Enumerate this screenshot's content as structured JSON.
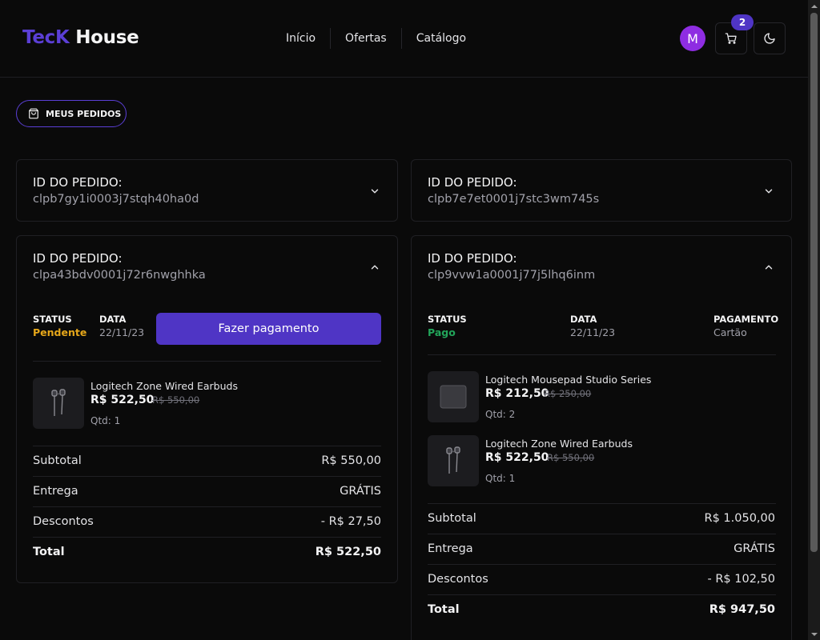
{
  "header": {
    "logo_part1": "TecK",
    "logo_part2": "House",
    "nav": [
      "Início",
      "Ofertas",
      "Catálogo"
    ],
    "avatar_initial": "M",
    "cart_count": "2",
    "icons": {
      "cart": "cart-icon",
      "theme": "moon-icon"
    }
  },
  "page_badge": {
    "label": "MEUS PEDIDOS",
    "icon": "shopping-bag-icon"
  },
  "labels": {
    "order_id": "ID DO PEDIDO:",
    "status": "STATUS",
    "date": "DATA",
    "payment": "PAGAMENTO",
    "pay_button": "Fazer pagamento",
    "subtotal": "Subtotal",
    "delivery": "Entrega",
    "discounts": "Descontos",
    "total": "Total"
  },
  "orders": [
    {
      "id": "clpb7gy1i0003j7stqh40ha0d",
      "expanded": false
    },
    {
      "id": "clpb7e7et0001j7stc3wm745s",
      "expanded": false
    },
    {
      "id": "clpa43bdv0001j72r6nwghhka",
      "expanded": true,
      "status": "Pendente",
      "date": "22/11/23",
      "products": [
        {
          "name": "Logitech Zone Wired Earbuds",
          "price": "R$ 522,50",
          "old_price": "R$ 550,00",
          "qty": "Qtd: 1",
          "image": "earbuds-image"
        }
      ],
      "subtotal": "R$ 550,00",
      "delivery": "GRÁTIS",
      "discounts": "- R$ 27,50",
      "total": "R$ 522,50"
    },
    {
      "id": "clp9vvw1a0001j77j5lhq6inm",
      "expanded": true,
      "status": "Pago",
      "date": "22/11/23",
      "payment": "Cartão",
      "products": [
        {
          "name": "Logitech Mousepad Studio Series",
          "price": "R$ 212,50",
          "old_price": "R$ 250,00",
          "qty": "Qtd: 2",
          "image": "mousepad-image"
        },
        {
          "name": "Logitech Zone Wired Earbuds",
          "price": "R$ 522,50",
          "old_price": "R$ 550,00",
          "qty": "Qtd: 1",
          "image": "earbuds-image"
        }
      ],
      "subtotal": "R$ 1.050,00",
      "delivery": "GRÁTIS",
      "discounts": "- R$ 102,50",
      "total": "R$ 947,50"
    }
  ],
  "colors": {
    "accent": "#4f35c5",
    "brand": "#5b3fd6",
    "pending": "#e6a71a",
    "paid": "#22a55a",
    "avatar": "#8e2de2"
  }
}
